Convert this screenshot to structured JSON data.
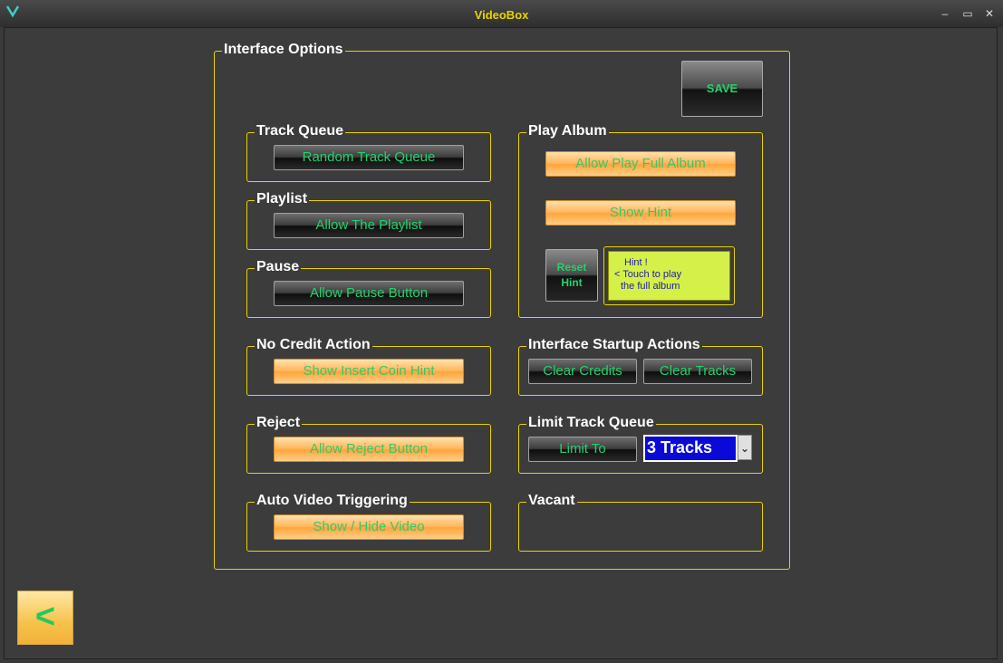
{
  "window": {
    "title": "VideoBox",
    "minimize": "–",
    "maximize": "▭",
    "close": "✕"
  },
  "main_panel": {
    "legend": "Interface Options",
    "save_label": "SAVE"
  },
  "track_queue": {
    "legend": "Track Queue",
    "button": "Random Track Queue"
  },
  "playlist": {
    "legend": "Playlist",
    "button": "Allow The Playlist"
  },
  "pause": {
    "legend": "Pause",
    "button": "Allow Pause Button"
  },
  "no_credit": {
    "legend": "No Credit Action",
    "button": "Show Insert Coin Hint"
  },
  "reject": {
    "legend": "Reject",
    "button": "Allow Reject Button"
  },
  "auto_video": {
    "legend": "Auto Video Triggering",
    "button": "Show / Hide Video"
  },
  "play_album": {
    "legend": "Play Album",
    "allow_button": "Allow Play Full Album",
    "hint_button": "Show Hint",
    "reset_line1": "Reset",
    "reset_line2": "Hint",
    "hint_line1": "Hint !",
    "hint_line2": "< Touch to play",
    "hint_line3": "the full album"
  },
  "startup": {
    "legend": "Interface Startup Actions",
    "clear_credits": "Clear Credits",
    "clear_tracks": "Clear Tracks"
  },
  "limit_queue": {
    "legend": "Limit Track Queue",
    "button": "Limit To",
    "selected": "3 Tracks"
  },
  "vacant": {
    "legend": "Vacant"
  },
  "back": {
    "label": "<"
  },
  "colors": {
    "accent": "#e8d300",
    "green_text": "#21d36a",
    "orange": "#ffb55a",
    "select_bg": "#0a0ad8"
  }
}
